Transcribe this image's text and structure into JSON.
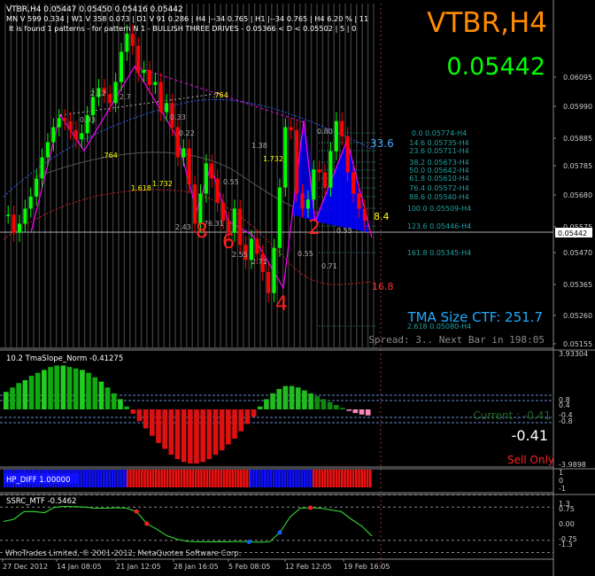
{
  "header": {
    "line1": "VTBR,H4  0.05447 0.05450 0.05416 0.05442",
    "line2": "MN  V 599   0.334  |  W1  V 358   0.073  |  D1  V 91   0.286  |  H4  |--34   0.765  |  H1  |--34   0.765  |  H4  6.20 %  |  11",
    "line3": "It is found 1 patterns  -  for pattern N 1 - BULLISH THREE DRIVES - 0.05366 < D < 0.05502 | 5 | 0"
  },
  "big_symbol": "VTBR,H4",
  "big_price": "0.05442",
  "tma_label": "TMA Size CTF:   251.7",
  "spread_label": "Spread: 3..  Next Bar in 198:05",
  "drive_labels": [
    "8",
    "6",
    "4",
    "2"
  ],
  "ratio_labels": [
    "2.12",
    "2.7",
    "0.93",
    ".764",
    "0.33",
    "0.22",
    ".764",
    "1.618",
    "1.732",
    "1.38",
    "1.732",
    "0.55",
    "76.31",
    "2.43",
    "2.55",
    "2.71",
    "0.55",
    "0.80",
    "0.71",
    "0.55"
  ],
  "level_labels": [
    "33.6",
    "8.4",
    "16.8"
  ],
  "fib_levels": [
    "0.0  0.05774-H4",
    "14.6  0.05735-H4",
    "23.6  0.05711-H4",
    "38.2  0.05673-H4",
    "50.0  0.05642-H4",
    "61.8  0.05610-H4",
    "76.4  0.05572-H4",
    "88.6  0.05540-H4",
    "100.0  0.05509-H4",
    "123.6  0.05446-H4",
    "161.8  0.05345-H4",
    "2.618  0.05080-H4"
  ],
  "price_axis": [
    "0.06095",
    "0.05990",
    "0.05885",
    "0.05785",
    "0.05680",
    "0.05575",
    "0.05470",
    "0.05365",
    "0.05260",
    "0.05155",
    "0.05050"
  ],
  "current_price_tag": "0.05442",
  "time_axis": [
    "27 Dec 2012",
    "14 Jan 08:05",
    "21 Jan 12:05",
    "28 Jan 16:05",
    "5 Feb 08:05",
    "12 Feb 12:05",
    "19 Feb 16:05"
  ],
  "copyright": "WhoTrades Limited, © 2001-2012, MetaQuotes Software Corp.",
  "tma_slope": {
    "title": "10.2 TmaSlope_Norm -0.41275",
    "current": "Current : -0.41",
    "value": "-0.41",
    "signal": "Sell Only",
    "axis": [
      "3.93304",
      "0.8",
      "0.4",
      "-0.4",
      "-0.8",
      "-3.9898"
    ]
  },
  "hp_diff": {
    "title": "HP_DIFF 1.00000",
    "axis": [
      "1",
      "0",
      "-1"
    ]
  },
  "ssrc": {
    "title": "SSRC_MTF -0.5462",
    "axis": [
      "1.3",
      "0.75",
      "0.00",
      "-0.75",
      "-1.3"
    ]
  },
  "colors": {
    "bull": "#00ff00",
    "bear": "#ff0000",
    "pattern_fill": "#0000ff",
    "drive_line": "#ff00ff",
    "label_red": "#ff2020",
    "tma_cyan": "#22aaff",
    "big_symbol": "#ff8c00",
    "big_price": "#00ff00",
    "hp_blue": "#1010ff",
    "hp_red": "#ee1111"
  },
  "chart_data": {
    "type": "candlestick",
    "title": "VTBR,H4",
    "ylim": [
      0.0502,
      0.0616
    ],
    "close_path": [
      0.0546,
      0.054,
      0.0543,
      0.0548,
      0.0552,
      0.0558,
      0.0565,
      0.057,
      0.0575,
      0.0578,
      0.0577,
      0.0574,
      0.0571,
      0.0573,
      0.0579,
      0.0585,
      0.0588,
      0.0586,
      0.0583,
      0.059,
      0.06,
      0.0606,
      0.0602,
      0.0593,
      0.0594,
      0.0589,
      0.059,
      0.058,
      0.0583,
      0.0575,
      0.0565,
      0.0568,
      0.0556,
      0.0543,
      0.0553,
      0.0563,
      0.0558,
      0.055,
      0.0544,
      0.054,
      0.0548,
      0.0536,
      0.0531,
      0.0538,
      0.0533,
      0.0527,
      0.052,
      0.0535,
      0.0555,
      0.0575,
      0.0574,
      0.0553,
      0.0548,
      0.0551,
      0.0561,
      0.056,
      0.0555,
      0.0567,
      0.0577,
      0.0572,
      0.056,
      0.0553,
      0.0548,
      0.0544
    ],
    "tma_slope": [
      1.2,
      1.5,
      1.8,
      2.0,
      2.3,
      2.5,
      2.7,
      2.9,
      3.0,
      3.0,
      2.9,
      2.8,
      2.7,
      2.5,
      2.2,
      1.9,
      1.5,
      1.1,
      0.7,
      0.2,
      -0.3,
      -0.8,
      -1.3,
      -1.8,
      -2.3,
      -2.7,
      -3.1,
      -3.4,
      -3.6,
      -3.7,
      -3.7,
      -3.6,
      -3.4,
      -3.1,
      -2.8,
      -2.4,
      -2.0,
      -1.5,
      -1.0,
      -0.5,
      0.2,
      0.7,
      1.1,
      1.4,
      1.6,
      1.6,
      1.5,
      1.3,
      1.1,
      0.9,
      0.7,
      0.5,
      0.3,
      0.1,
      -0.1,
      -0.25,
      -0.35,
      -0.41
    ],
    "hp_diff": [
      1,
      -1,
      1,
      -1,
      1,
      -1
    ],
    "ssrc": [
      0.1,
      0.2,
      0.55,
      0.55,
      0.5,
      0.75,
      0.78,
      0.77,
      0.75,
      0.7,
      0.7,
      0.72,
      0.7,
      0.55,
      0.0,
      -0.25,
      -0.55,
      -0.7,
      -0.8,
      -0.82,
      -0.82,
      -0.81,
      -0.82,
      -0.8,
      -0.82,
      -0.83,
      -0.82,
      -0.4,
      0.3,
      0.7,
      0.72,
      0.7,
      0.62,
      0.55,
      0.2,
      -0.1,
      -0.55
    ]
  }
}
